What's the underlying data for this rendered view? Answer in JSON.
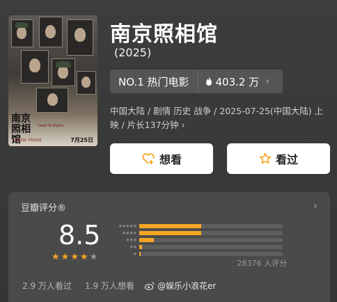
{
  "movie": {
    "title": "南京照相馆",
    "year": "(2025)",
    "rank_label": "NO.1 热门电影",
    "heat": "403.2 万",
    "meta": "中国大陆 / 剧情 历史 战争 / 2025-07-25(中国大陆) 上映 / 片长137分钟 ›"
  },
  "poster": {
    "title": "南京照相馆",
    "subtitle": "Dead To Rights",
    "dates": "7月25日–7月25日",
    "release": "7月25日"
  },
  "buttons": {
    "want_label": "想看",
    "seen_label": "看过"
  },
  "rating": {
    "title": "豆瓣评分®",
    "score": "8.5",
    "stars_filled": 4,
    "stars_total": 5,
    "distribution_fraction": [
      0.43,
      0.43,
      0.1,
      0.02,
      0.01
    ],
    "count_text": "28376 人评分",
    "watched_text": "2.9 万人看过",
    "wanting_text": "1.9 万人想看"
  },
  "watermark": "@娱乐小浪花er",
  "colors": {
    "accent_star": "#f6a623",
    "want_icon": "#f6a623",
    "seen_icon": "#f6a623"
  }
}
